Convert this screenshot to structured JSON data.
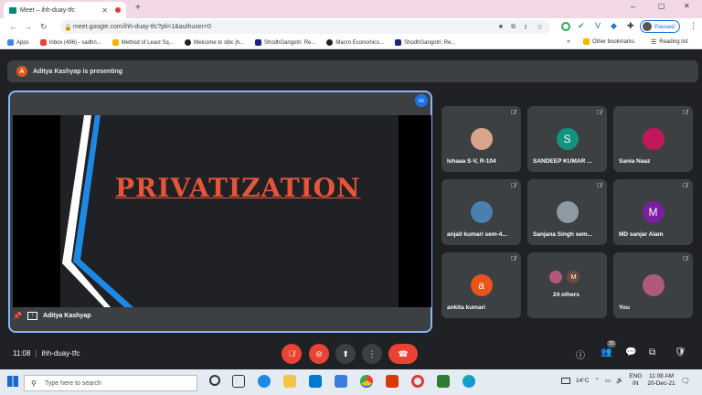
{
  "browser": {
    "tab_title": "Meet – ihh-duay-tfc",
    "url": "meet.google.com/ihh-duay-tfc?pli=1&authuser=0",
    "profile_label": "Paused",
    "bookmarks": [
      {
        "label": "Apps",
        "color": "#4285f4"
      },
      {
        "label": "Inbox (496) - sadhn...",
        "color": "#ea4335"
      },
      {
        "label": "Method of Least Sq...",
        "color": "#f4b400"
      },
      {
        "label": "Welcome to slbc jh...",
        "color": "#222222"
      },
      {
        "label": "ShodhGangotri: Re...",
        "color": "#1a237e"
      },
      {
        "label": "Macro Economics...",
        "color": "#222222"
      },
      {
        "label": "ShodhGangotri: Re...",
        "color": "#1a237e"
      }
    ],
    "other_bookmarks": "Other bookmarks",
    "reading_list": "Reading list"
  },
  "meet": {
    "presenting_banner": "Aditya Kashyap is presenting",
    "presenter_initial": "A",
    "slide_title": "PRIVATIZATION",
    "stage_name": "Aditya Kashyap",
    "meeting_time": "11:08",
    "meeting_code": "ihh-duay-tfc",
    "participant_count_badge": "33",
    "participants": [
      {
        "name": "Ishaaa S-V, R-104",
        "initial": "",
        "color": "#d7a58a"
      },
      {
        "name": "SANDEEP KUMAR ...",
        "initial": "S",
        "color": "#12937f"
      },
      {
        "name": "Sania Naaz",
        "initial": "",
        "color": "#c2185b"
      },
      {
        "name": "anjali kumari sem-4...",
        "initial": "",
        "color": "#4a7fb0"
      },
      {
        "name": "Sanjana Singh sem...",
        "initial": "",
        "color": "#8d9aa6"
      },
      {
        "name": "MD sanjar Alam",
        "initial": "M",
        "color": "#7b1fa2"
      },
      {
        "name": "ankita kumari",
        "initial": "a",
        "color": "#e8541a"
      },
      {
        "name": "24 others",
        "initial": "M",
        "color": "#6d4c41"
      },
      {
        "name": "You",
        "initial": "",
        "color": "#b05a7a"
      }
    ]
  },
  "taskbar": {
    "search_placeholder": "Type here to search",
    "temperature": "14°C",
    "language": "ENG",
    "region": "IN",
    "time": "11:08 AM",
    "date": "20-Dec-21"
  },
  "colors": {
    "accent_blue": "#8ab4f8",
    "end_call_red": "#ea4335",
    "slide_title": "#e6553a"
  }
}
